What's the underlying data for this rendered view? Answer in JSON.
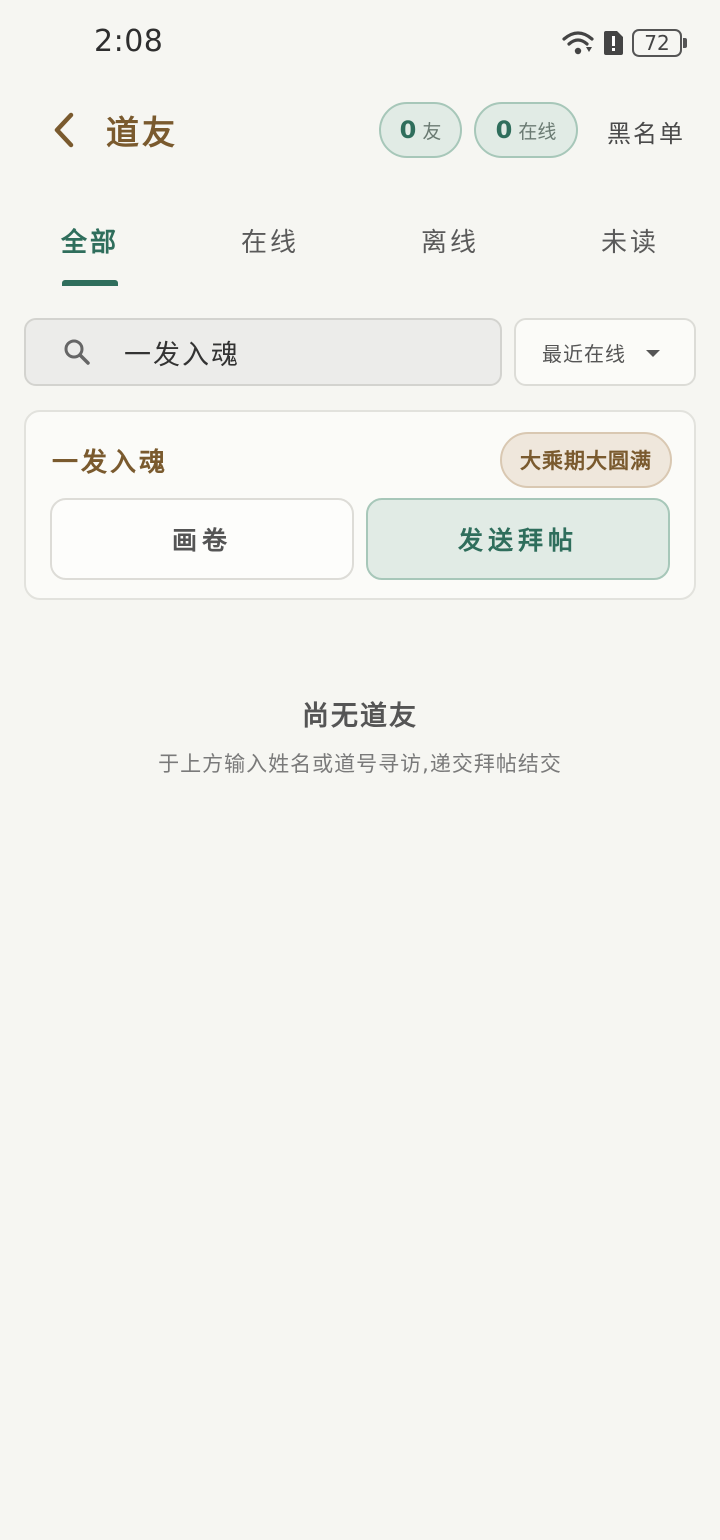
{
  "status_bar": {
    "time": "2:08",
    "battery": "72",
    "icons": [
      "wifi-icon",
      "alert-icon",
      "battery-icon"
    ]
  },
  "header": {
    "title": "道友",
    "friends_count": "0",
    "friends_label": "友",
    "online_count": "0",
    "online_label": "在线",
    "blacklist_label": "黑名单"
  },
  "tabs": [
    {
      "label": "全部",
      "active": true
    },
    {
      "label": "在线",
      "active": false
    },
    {
      "label": "离线",
      "active": false
    },
    {
      "label": "未读",
      "active": false
    }
  ],
  "search": {
    "value": "一发入魂",
    "placeholder": "",
    "sort_selected": "最近在线"
  },
  "result_card": {
    "name": "一发入魂",
    "realm": "大乘期大圆满",
    "scroll_button": "画卷",
    "send_button": "发送拜帖"
  },
  "empty_state": {
    "title": "尚无道友",
    "description": "于上方输入姓名或道号寻访,递交拜帖结交"
  },
  "colors": {
    "accent_green": "#2f6e5c",
    "accent_brown": "#7a5a2e",
    "background": "#f6f6f2"
  }
}
